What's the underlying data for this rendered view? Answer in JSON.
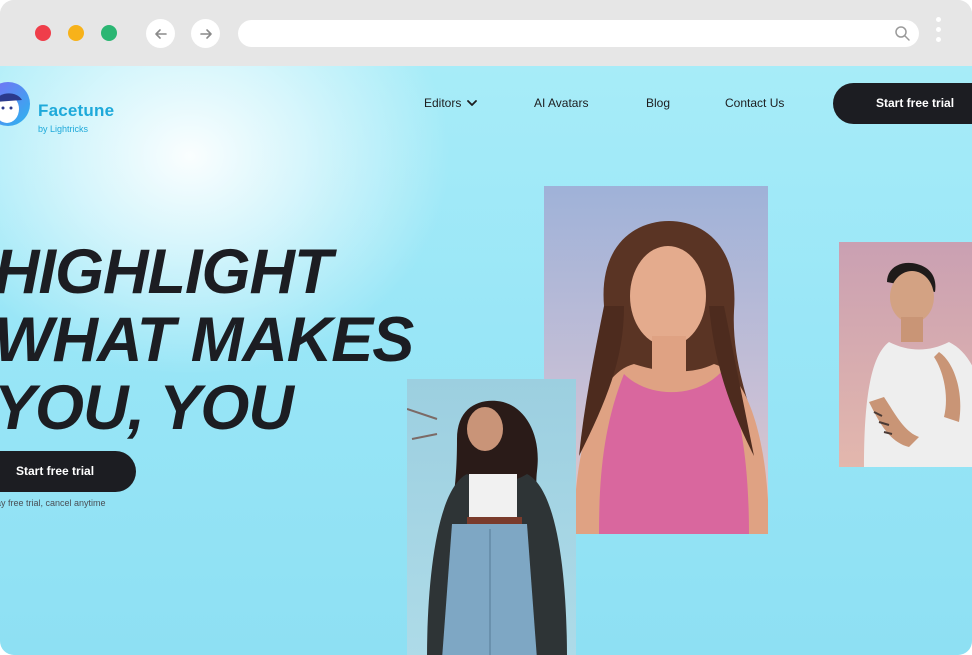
{
  "browser": {
    "back_icon": "arrow-left-icon",
    "forward_icon": "arrow-right-icon",
    "url": "",
    "search_icon": "search-icon",
    "menu_icon": "kebab-menu-icon"
  },
  "header": {
    "brand": "Facetune",
    "tagline": "by Lightricks",
    "nav": {
      "editors": "Editors",
      "ai_avatars": "AI Avatars",
      "blog": "Blog",
      "contact": "Contact Us"
    },
    "cta": "Start free trial"
  },
  "hero": {
    "headline_lines": [
      "HIGHLIGHT",
      "WHAT MAKES",
      "YOU, YOU"
    ],
    "cta": "Start free trial",
    "fine_print": "ay free trial, cancel anytime"
  },
  "colors": {
    "brand": "#1ea9da",
    "background": "#99e6f7",
    "button": "#1c1d22",
    "traffic_red": "#ef3e4a",
    "traffic_yellow": "#f7b21a",
    "traffic_green": "#2bb673"
  }
}
